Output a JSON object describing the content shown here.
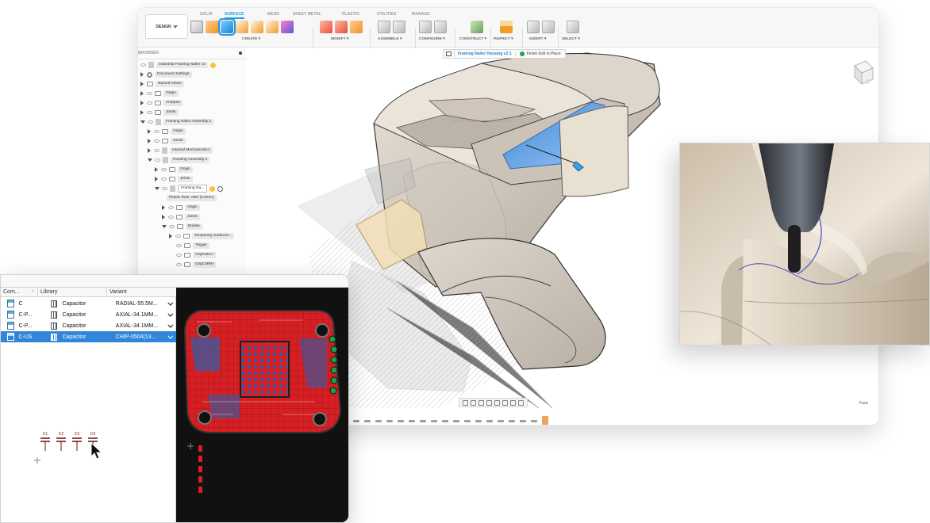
{
  "app": {
    "design_label": "DESIGN",
    "ribbon_tabs": [
      "SOLID",
      "SURFACE",
      "MESH",
      "SHEET METAL",
      "PLASTIC",
      "UTILITIES",
      "MANAGE"
    ],
    "active_tab": "SURFACE",
    "tool_groups": [
      {
        "label": "CREATE ▾",
        "icons": [
          "sketch-icon",
          "orange-surface-icon",
          "surface-patch-icon",
          "extrude-icon",
          "loft-icon",
          "boundary-fill-icon",
          "sculpt-icon"
        ]
      },
      {
        "label": "MODIFY ▾",
        "icons": [
          "trim-icon",
          "delete-face-icon",
          "press-pull-icon"
        ]
      },
      {
        "label": "ASSEMBLE ▾",
        "icons": [
          "joint-icon",
          "assembly-icon"
        ]
      },
      {
        "label": "CONFIGURE ▾",
        "icons": [
          "table-icon",
          "configure-icon"
        ]
      },
      {
        "label": "CONSTRUCT ▾",
        "icons": [
          "plane-icon"
        ]
      },
      {
        "label": "INSPECT ▾",
        "icons": [
          "measure-icon"
        ]
      },
      {
        "label": "INSERT ▾",
        "icons": [
          "insert-icon",
          "canvas-icon"
        ]
      },
      {
        "label": "SELECT ▾",
        "icons": [
          "select-icon"
        ]
      }
    ]
  },
  "browser": {
    "title": "BROWSER",
    "items": [
      {
        "label": "Industrial Framing Nailer v3",
        "level": 0,
        "arrow": "none",
        "active": false
      },
      {
        "label": "Document Settings",
        "level": 1,
        "arrow": "right",
        "active": false
      },
      {
        "label": "Named Views",
        "level": 1,
        "arrow": "right",
        "active": false
      },
      {
        "label": "Origin",
        "level": 1,
        "arrow": "right",
        "active": false
      },
      {
        "label": "Analysis",
        "level": 1,
        "arrow": "right",
        "active": false
      },
      {
        "label": "Joints",
        "level": 1,
        "arrow": "right",
        "active": false
      },
      {
        "label": "Framing Nailer Assembly:1",
        "level": 1,
        "arrow": "down",
        "active": false
      },
      {
        "label": "Origin",
        "level": 2,
        "arrow": "right",
        "active": false
      },
      {
        "label": "Joints",
        "level": 2,
        "arrow": "right",
        "active": false
      },
      {
        "label": "Internal Mechanicals:1",
        "level": 2,
        "arrow": "right",
        "active": false
      },
      {
        "label": "Housing Assembly:1",
        "level": 2,
        "arrow": "down",
        "active": false
      },
      {
        "label": "Origin",
        "level": 3,
        "arrow": "right",
        "active": false
      },
      {
        "label": "Joints",
        "level": 3,
        "arrow": "right",
        "active": false
      },
      {
        "label": "Framing Na...",
        "level": 3,
        "arrow": "down",
        "active": true
      },
      {
        "label": "Plastic Rule: ABS (3.0mm)",
        "level": 4,
        "arrow": "none",
        "active": false
      },
      {
        "label": "Origin",
        "level": 4,
        "arrow": "right",
        "active": false
      },
      {
        "label": "Joints",
        "level": 4,
        "arrow": "right",
        "active": false
      },
      {
        "label": "Bodies",
        "level": 4,
        "arrow": "down",
        "active": false
      },
      {
        "label": "Temporary Surfacon...",
        "level": 5,
        "arrow": "right",
        "active": false
      },
      {
        "label": "Trigger",
        "level": 5,
        "arrow": "none",
        "active": false
      },
      {
        "label": "GripCMLH",
        "level": 5,
        "arrow": "none",
        "active": false
      },
      {
        "label": "GripCMRH",
        "level": 5,
        "arrow": "none",
        "active": false
      }
    ]
  },
  "breadcrumb": {
    "component": "Framing Nailer Housing v2:1",
    "finish_label": "Finish Edit In Place"
  },
  "viewport": {
    "status": "Face"
  },
  "pcb": {
    "columns": [
      "Com...",
      "Library",
      "Variant"
    ],
    "rows": [
      {
        "component": "C",
        "library": "Capacitor",
        "variant": "RADIAL-55.5M...",
        "selected": false
      },
      {
        "component": "C-P...",
        "library": "Capacitor",
        "variant": "AXIAL-34.1MM...",
        "selected": false
      },
      {
        "component": "C-P...",
        "library": "Capacitor",
        "variant": "AXIAL-34.1MM...",
        "selected": false
      },
      {
        "component": "C-US",
        "library": "Capacitor",
        "variant": "CHIP-0504(13...",
        "selected": true
      }
    ],
    "symbol_labels": [
      "C1",
      "C2",
      "C3",
      "C4"
    ]
  },
  "colors": {
    "accent_blue": "#169be8",
    "selection_blue": "#3186d9",
    "pcb_red": "#d61f24",
    "pcb_blue": "#1e5b9f",
    "tool_gray": "#6d6d6d",
    "model_tan": "#d8d0c3"
  }
}
